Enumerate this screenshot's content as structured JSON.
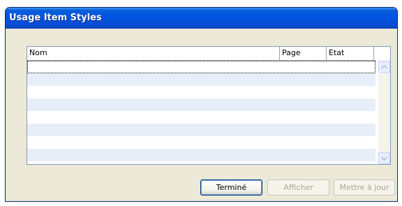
{
  "window": {
    "title": "Usage Item Styles"
  },
  "list": {
    "columns": [
      "Nom",
      "Page",
      "Etat"
    ],
    "rows": []
  },
  "buttons": {
    "done": "Terminé",
    "show": "Afficher",
    "update": "Mettre à jour"
  },
  "colors": {
    "titlebar": "#0054e3",
    "dialog_bg": "#ece9d8",
    "row_alt": "#e8eef8"
  }
}
